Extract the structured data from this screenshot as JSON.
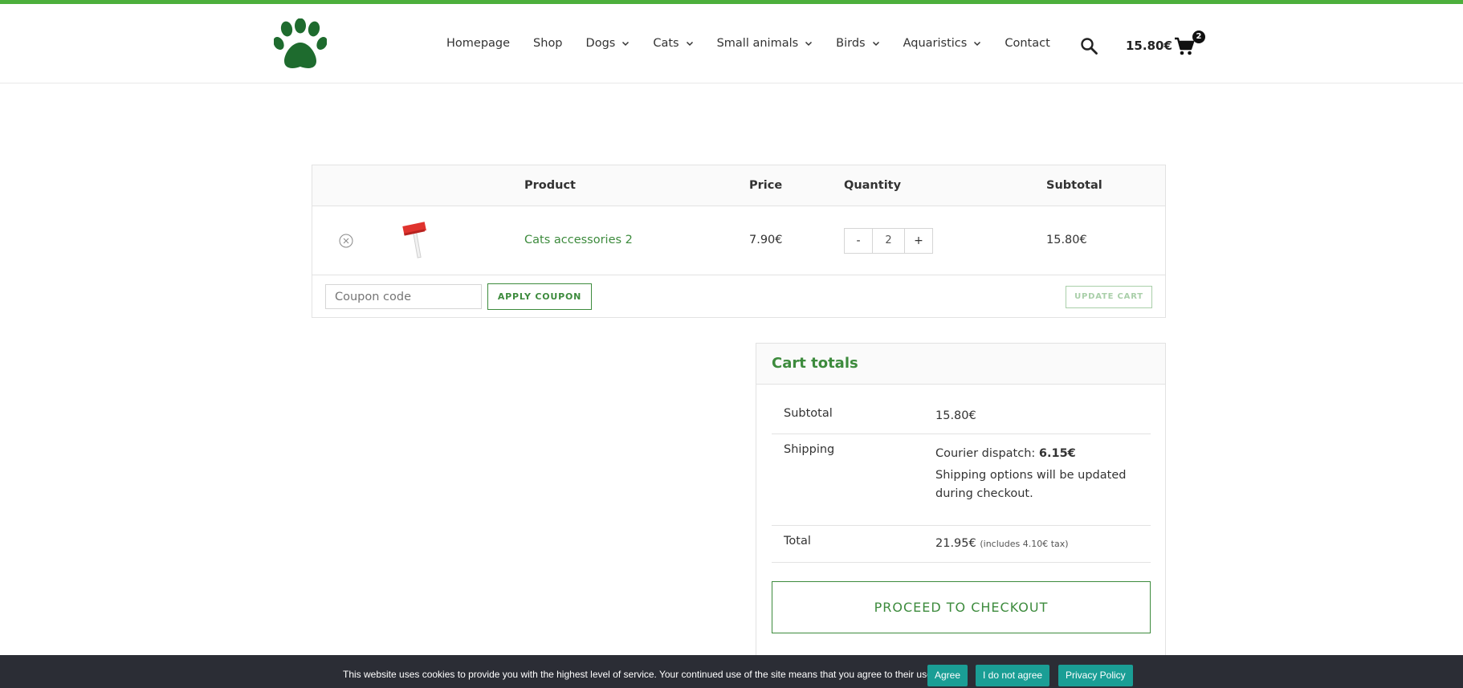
{
  "colors": {
    "accent_green": "#3d8b3d",
    "top_bar": "#4caf3c",
    "logo_green": "#1e6b2e",
    "cookie_bar_bg": "#2b2d35",
    "cookie_button": "#1a9e95"
  },
  "header": {
    "logo_icon": "paw-icon",
    "nav": [
      {
        "label": "Homepage",
        "has_dropdown": false
      },
      {
        "label": "Shop",
        "has_dropdown": false
      },
      {
        "label": "Dogs",
        "has_dropdown": true
      },
      {
        "label": "Cats",
        "has_dropdown": true
      },
      {
        "label": "Small animals",
        "has_dropdown": true
      },
      {
        "label": "Birds",
        "has_dropdown": true
      },
      {
        "label": "Aquaristics",
        "has_dropdown": true
      },
      {
        "label": "Contact",
        "has_dropdown": false
      }
    ],
    "search_icon": "search-icon",
    "cart_amount": "15.80€",
    "cart_icon": "shopping-cart-icon",
    "cart_count": "2"
  },
  "cart": {
    "columns": {
      "product": "Product",
      "price": "Price",
      "quantity": "Quantity",
      "subtotal": "Subtotal"
    },
    "items": [
      {
        "name": "Cats accessories 2",
        "price": "7.90€",
        "quantity": "2",
        "subtotal": "15.80€",
        "minus": "-",
        "plus": "+"
      }
    ],
    "coupon_placeholder": "Coupon code",
    "apply_coupon": "APPLY COUPON",
    "update_cart": "UPDATE CART"
  },
  "totals": {
    "title": "Cart totals",
    "subtotal_label": "Subtotal",
    "subtotal_value": "15.80€",
    "shipping_label": "Shipping",
    "shipping_method": "Courier dispatch: ",
    "shipping_price": "6.15€",
    "shipping_note": "Shipping options will be updated during checkout.",
    "total_label": "Total",
    "total_value": "21.95€",
    "total_tax": "(includes 4.10€ tax)",
    "checkout_button": "PROCEED TO CHECKOUT"
  },
  "cookie": {
    "text": "This website uses cookies to provide you with the highest level of service. Your continued use of the site means that you agree to their use.",
    "agree": "Agree",
    "disagree": "I do not agree",
    "policy": "Privacy Policy"
  }
}
